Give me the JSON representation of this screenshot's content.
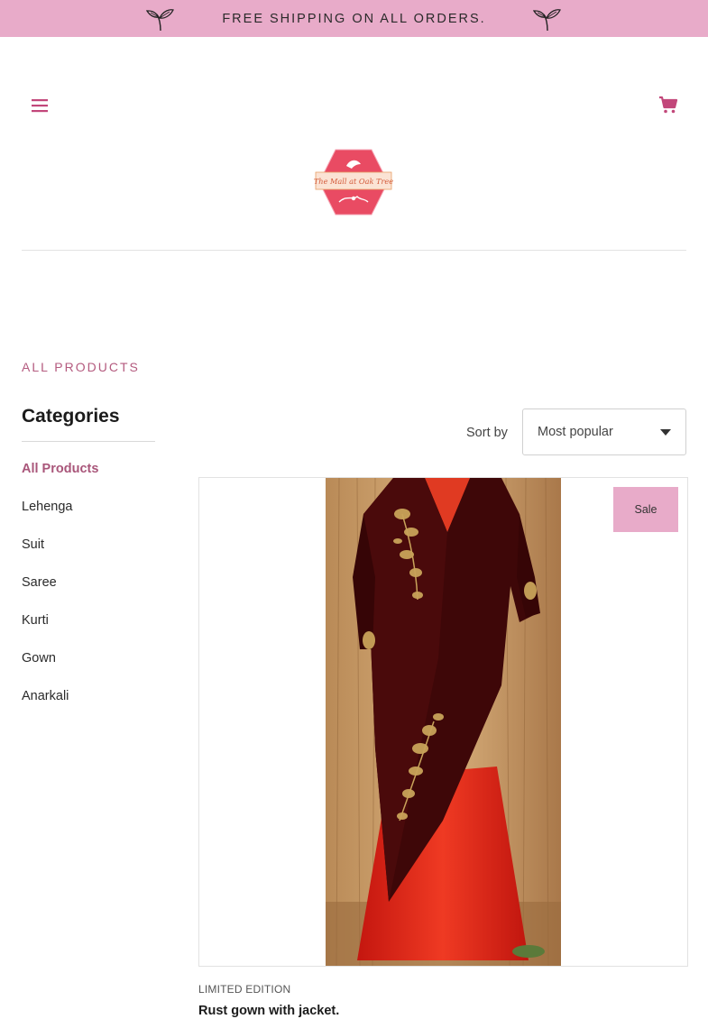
{
  "promo": {
    "text": "FREE SHIPPING ON ALL ORDERS."
  },
  "header": {
    "logo_text": "The Mall at Oak Tree"
  },
  "breadcrumb": {
    "label": "ALL PRODUCTS"
  },
  "sidebar": {
    "title": "Categories",
    "items": [
      {
        "label": "All Products",
        "active": true
      },
      {
        "label": "Lehenga"
      },
      {
        "label": "Suit"
      },
      {
        "label": "Saree"
      },
      {
        "label": "Kurti"
      },
      {
        "label": "Gown"
      },
      {
        "label": "Anarkali"
      }
    ]
  },
  "sort": {
    "label": "Sort by",
    "selected": "Most popular"
  },
  "products": [
    {
      "badge": "Sale",
      "tag": "LIMITED EDITION",
      "name": "Rust gown with jacket."
    }
  ],
  "colors": {
    "accent": "#e8abc9",
    "active_link": "#a9567a",
    "brand_red": "#e94b63"
  }
}
